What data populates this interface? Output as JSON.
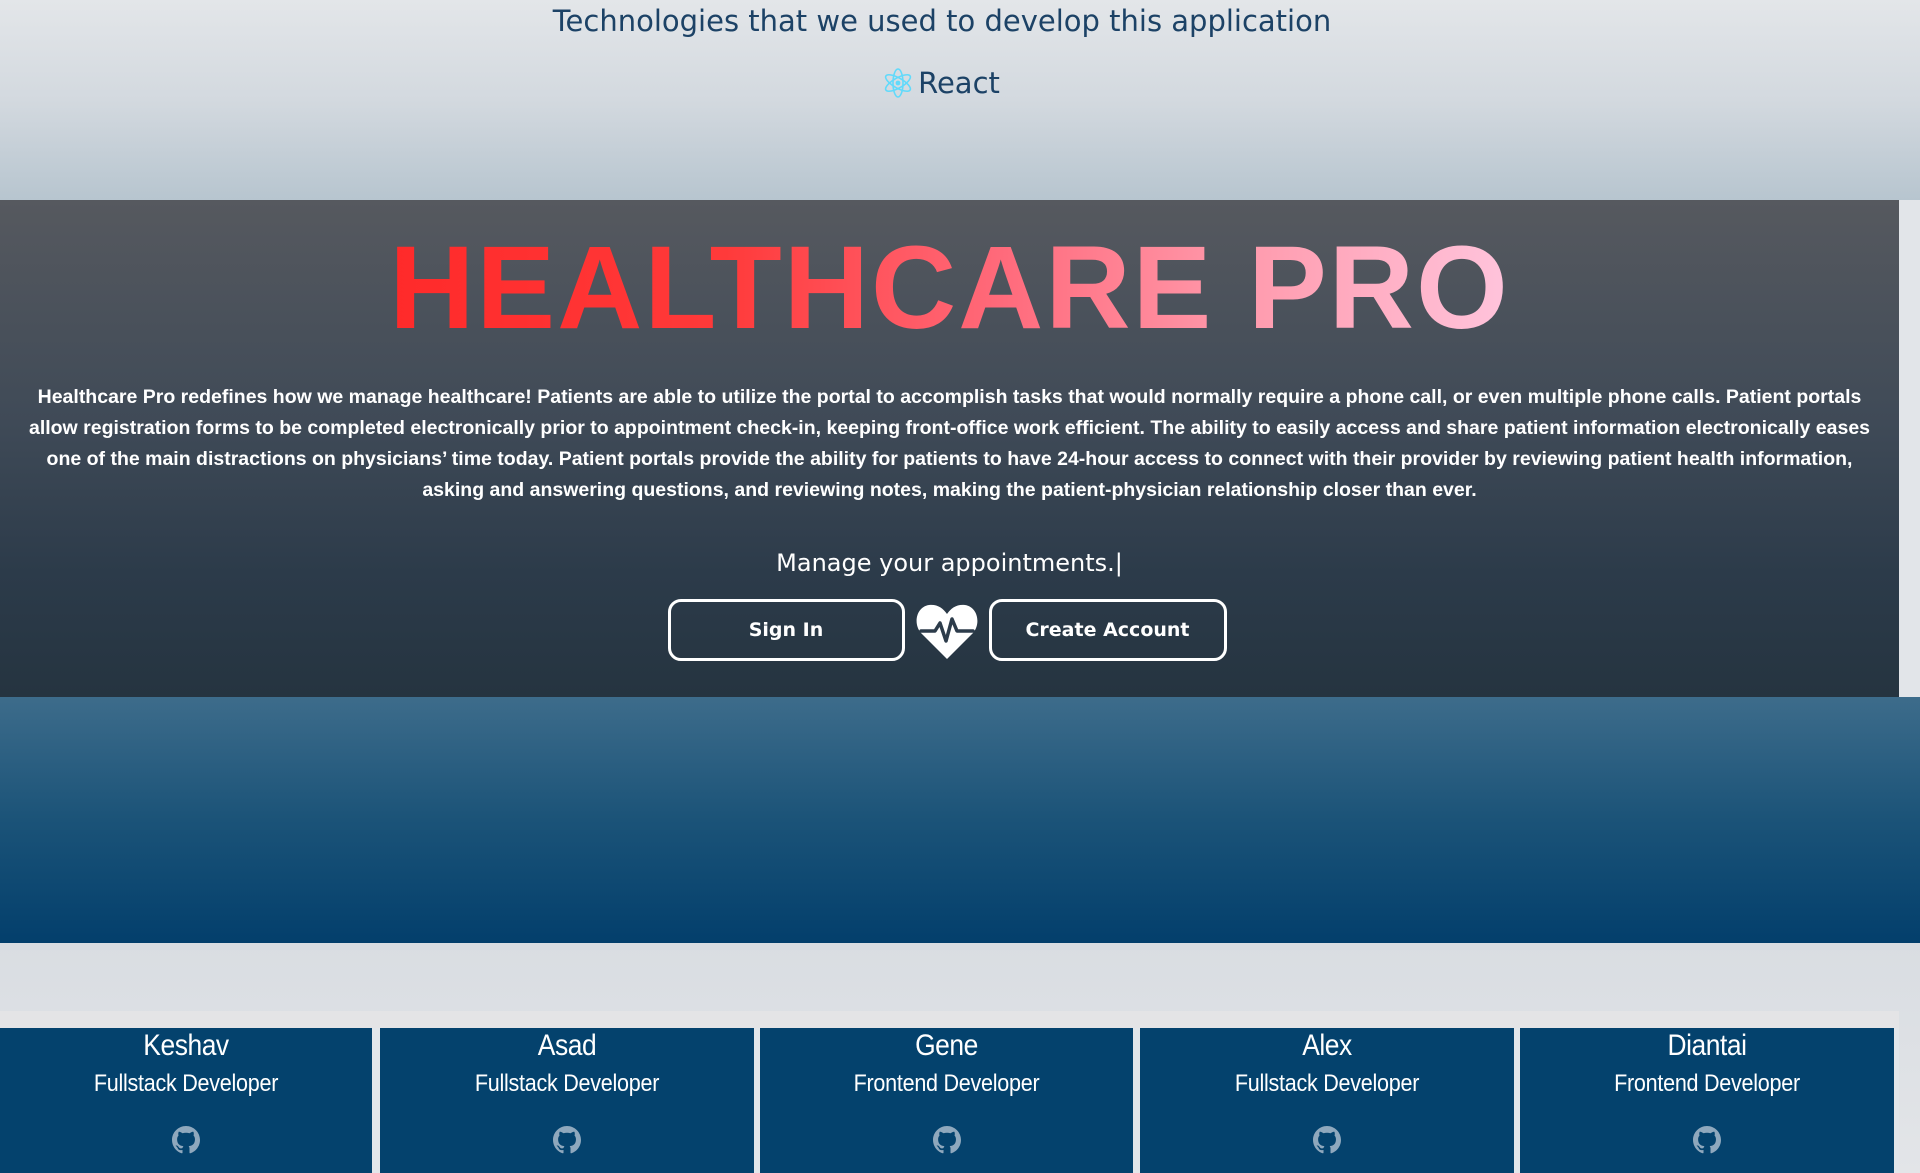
{
  "tech": {
    "title": "Technologies that we used to develop this application",
    "items": [
      {
        "label": "React",
        "icon": "react-icon",
        "icon_color": "#61dafb"
      }
    ]
  },
  "hero": {
    "brand": "HEALTHCARE PRO",
    "brand_gradient": [
      "#ff2a2a",
      "#ff6b7c",
      "#ffc4dc"
    ],
    "description": "Healthcare Pro redefines how we manage healthcare! Patients are able to utilize the portal to accomplish tasks that would normally require a phone call, or even multiple phone calls. Patient portals allow registration forms to be completed electronically prior to appointment check-in, keeping front-office work efficient. The ability to easily access and share patient information electronically eases one of the main distractions on physicians’ time today. Patient portals provide the ability for patients to have 24-hour access to connect with their provider by reviewing patient health information, asking and answering questions, and reviewing notes, making the patient-physician relationship closer than ever.",
    "typing_text": "Manage your appointments.|",
    "sign_in_label": "Sign In",
    "create_account_label": "Create Account",
    "center_icon": "heartbeat-icon"
  },
  "team": [
    {
      "name": "Keshav",
      "role": "Fullstack Developer",
      "icon": "github-icon"
    },
    {
      "name": "Asad",
      "role": "Fullstack Developer",
      "icon": "github-icon"
    },
    {
      "name": "Gene",
      "role": "Frontend Developer",
      "icon": "github-icon"
    },
    {
      "name": "Alex",
      "role": "Fullstack Developer",
      "icon": "github-icon"
    },
    {
      "name": "Diantai",
      "role": "Frontend Developer",
      "icon": "github-icon"
    }
  ],
  "colors": {
    "heading_text": "#1c4266",
    "card_bg": "#04426d",
    "blue_band": "#033f6c"
  }
}
